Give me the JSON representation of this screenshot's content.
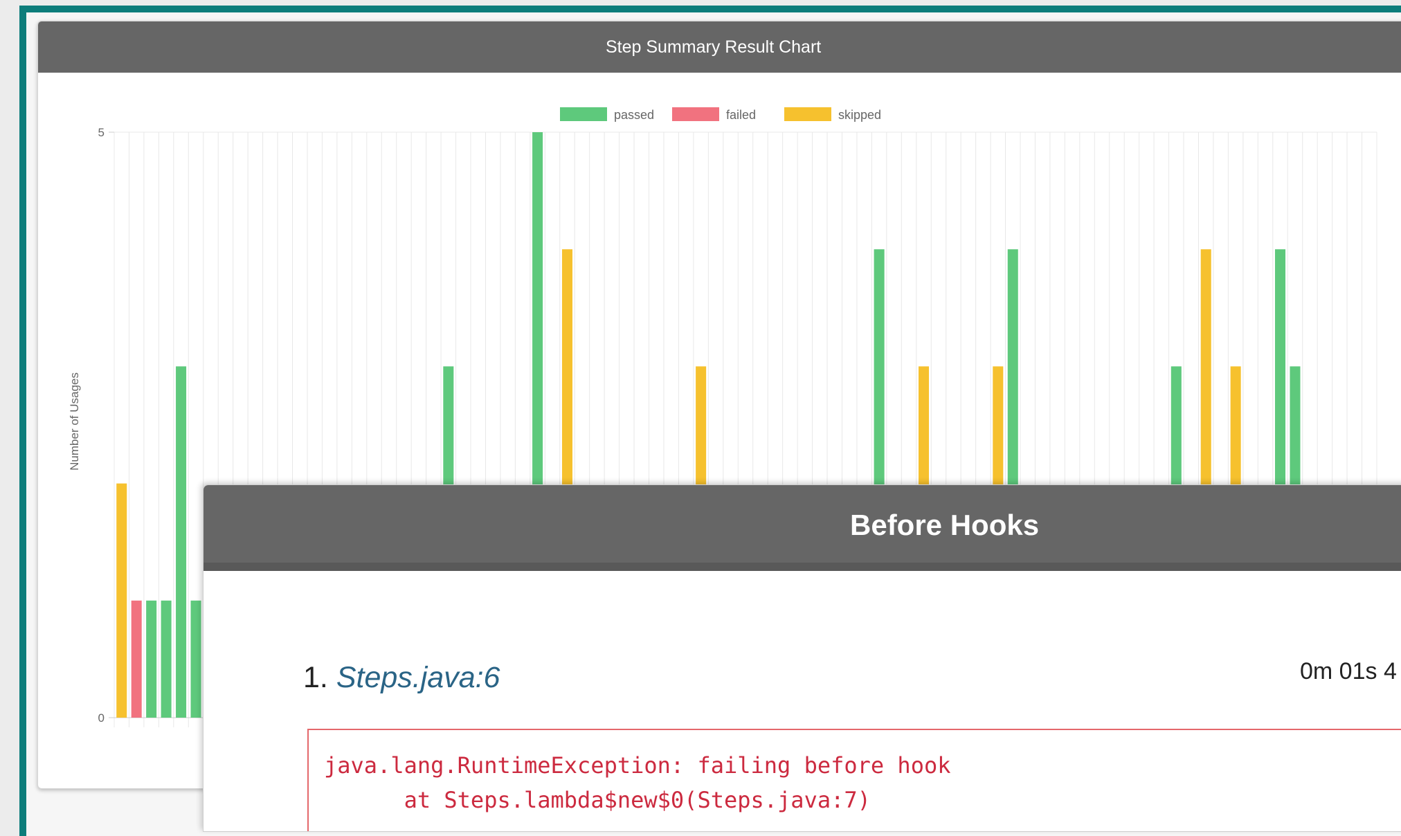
{
  "chart_panel": {
    "title": "Step Summary Result Chart"
  },
  "chart_data": {
    "type": "bar",
    "ylabel": "Number of Usages",
    "ylim": [
      0,
      5
    ],
    "yticks": [
      0,
      5
    ],
    "grid": true,
    "legend_position": "top-center",
    "series": [
      {
        "name": "passed",
        "color": "#5ec97c"
      },
      {
        "name": "failed",
        "color": "#f1727f"
      },
      {
        "name": "skipped",
        "color": "#f6c12e"
      }
    ],
    "visible_bars": [
      {
        "series": "skipped",
        "index": 0,
        "value": 2
      },
      {
        "series": "failed",
        "index": 1,
        "value": 1
      },
      {
        "series": "passed",
        "index": 2,
        "value": 1
      },
      {
        "series": "passed",
        "index": 3,
        "value": 1
      },
      {
        "series": "passed",
        "index": 4,
        "value": 3
      },
      {
        "series": "passed",
        "index": 5,
        "value": 1
      },
      {
        "series": "passed",
        "index": 22,
        "value": 3
      },
      {
        "series": "passed",
        "index": 28,
        "value": 5
      },
      {
        "series": "skipped",
        "index": 30,
        "value": 4
      },
      {
        "series": "skipped",
        "index": 39,
        "value": 3
      },
      {
        "series": "passed",
        "index": 51,
        "value": 4
      },
      {
        "series": "skipped",
        "index": 54,
        "value": 3
      },
      {
        "series": "skipped",
        "index": 59,
        "value": 3
      },
      {
        "series": "passed",
        "index": 60,
        "value": 4
      },
      {
        "series": "passed",
        "index": 71,
        "value": 3
      },
      {
        "series": "skipped",
        "index": 73,
        "value": 4
      },
      {
        "series": "skipped",
        "index": 75,
        "value": 3
      },
      {
        "series": "passed",
        "index": 78,
        "value": 4
      },
      {
        "series": "passed",
        "index": 79,
        "value": 3
      }
    ]
  },
  "hooks_panel": {
    "title": "Before Hooks",
    "items": [
      {
        "index": "1.",
        "location": "Steps.java:6",
        "duration": "0m 01s 4",
        "error_lines": [
          "java.lang.RuntimeException: failing before hook",
          "      at Steps.lambda$new$0(Steps.java:7)"
        ]
      }
    ]
  }
}
